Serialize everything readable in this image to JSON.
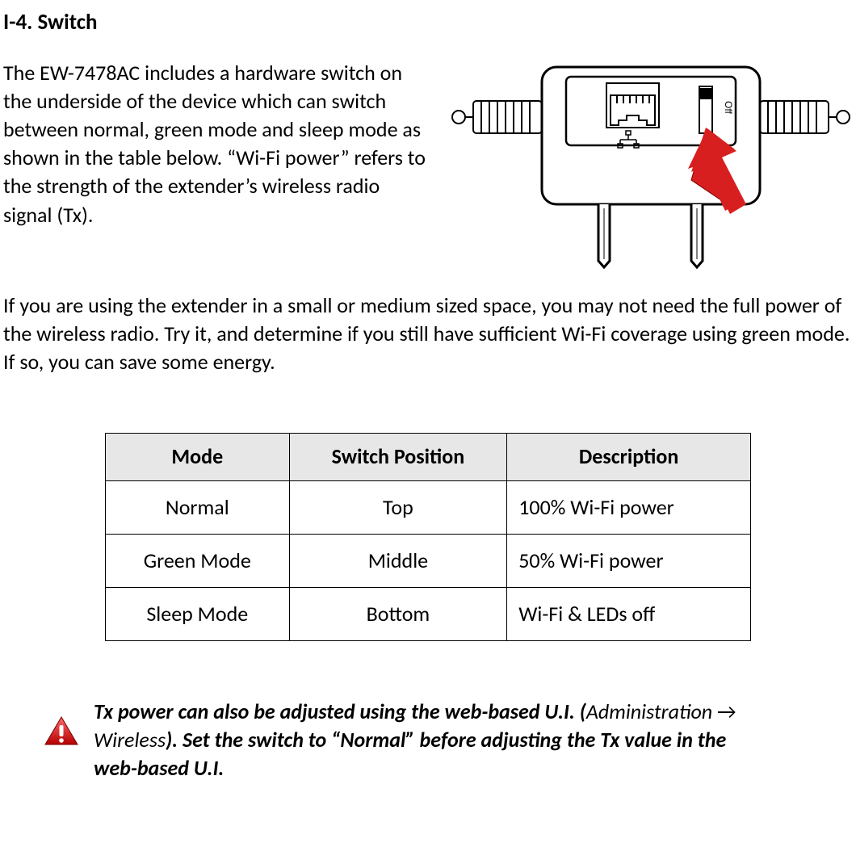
{
  "heading": "I-4. Switch",
  "paragraph1": "The EW-7478AC includes a hardware switch on the underside of the device which can switch between normal, green mode and sleep mode as shown in the table below. “Wi-Fi power” refers to the strength of the extender’s wireless radio signal (Tx).",
  "paragraph2": "If you are using the extender in a small or medium sized space, you may not need the full power of the wireless radio. Try it, and determine if you still have sufficient Wi-Fi coverage using green mode. If so, you can save some energy.",
  "table": {
    "headers": {
      "mode": "Mode",
      "position": "Switch Position",
      "description": "Description"
    },
    "rows": [
      {
        "mode": "Normal",
        "position": "Top",
        "description": "100% Wi-Fi power"
      },
      {
        "mode": "Green Mode",
        "position": "Middle",
        "description": "50% Wi-Fi power"
      },
      {
        "mode": "Sleep Mode",
        "position": "Bottom",
        "description": "Wi-Fi & LEDs off"
      }
    ]
  },
  "note": {
    "part1": "Tx power can also be adjusted using the web-based U.I. (",
    "part2_light": "Administration ",
    "arrow": "→",
    "part3_light": " Wireless",
    "part4": "). Set the switch to “Normal” before adjusting the Tx value in the web-based U.I."
  },
  "diagram_label_off": "Off"
}
